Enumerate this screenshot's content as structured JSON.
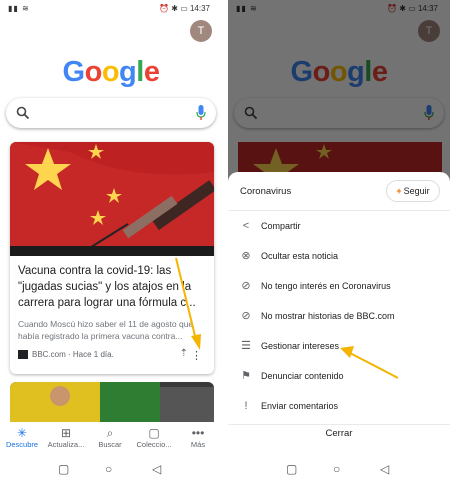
{
  "status": {
    "time": "14:37"
  },
  "avatar_letter": "T",
  "logo_letters": [
    "G",
    "o",
    "o",
    "g",
    "l",
    "e"
  ],
  "card": {
    "title": "Vacuna contra la covid-19: las \"jugadas sucias\" y los atajos en la carrera para lograr una fórmula c...",
    "snippet": "Cuando Moscú hizo saber el 11 de agosto que había registrado la primera vacuna contra...",
    "source": "BBC.com · Hace 1 día."
  },
  "bottom_nav": [
    {
      "label": "Descubre",
      "icon": "asterisk-icon",
      "glyph": "✳"
    },
    {
      "label": "Actualiza...",
      "icon": "inbox-icon",
      "glyph": "⊞"
    },
    {
      "label": "Buscar",
      "icon": "search-icon",
      "glyph": "⌕"
    },
    {
      "label": "Coleccio...",
      "icon": "collections-icon",
      "glyph": "▢"
    },
    {
      "label": "Más",
      "icon": "more-icon",
      "glyph": "•••"
    }
  ],
  "sheet": {
    "title": "Coronavirus",
    "follow_label": "Seguir",
    "options": [
      {
        "label": "Compartir",
        "icon": "share-icon",
        "glyph": "<"
      },
      {
        "label": "Ocultar esta noticia",
        "icon": "hide-icon",
        "glyph": "⊗"
      },
      {
        "label": "No tengo interés en Coronavirus",
        "icon": "block-icon",
        "glyph": "⊘"
      },
      {
        "label": "No mostrar historias de BBC.com",
        "icon": "block-icon",
        "glyph": "⊘"
      },
      {
        "label": "Gestionar intereses",
        "icon": "tune-icon",
        "glyph": "☰"
      },
      {
        "label": "Denunciar contenido",
        "icon": "flag-icon",
        "glyph": "⚑"
      },
      {
        "label": "Enviar comentarios",
        "icon": "feedback-icon",
        "glyph": "!"
      }
    ],
    "close_label": "Cerrar"
  },
  "colors": {
    "accent": "#1a73e8",
    "arrow": "#f4b400",
    "flag_red": "#c62828",
    "star": "#ffd54f"
  }
}
